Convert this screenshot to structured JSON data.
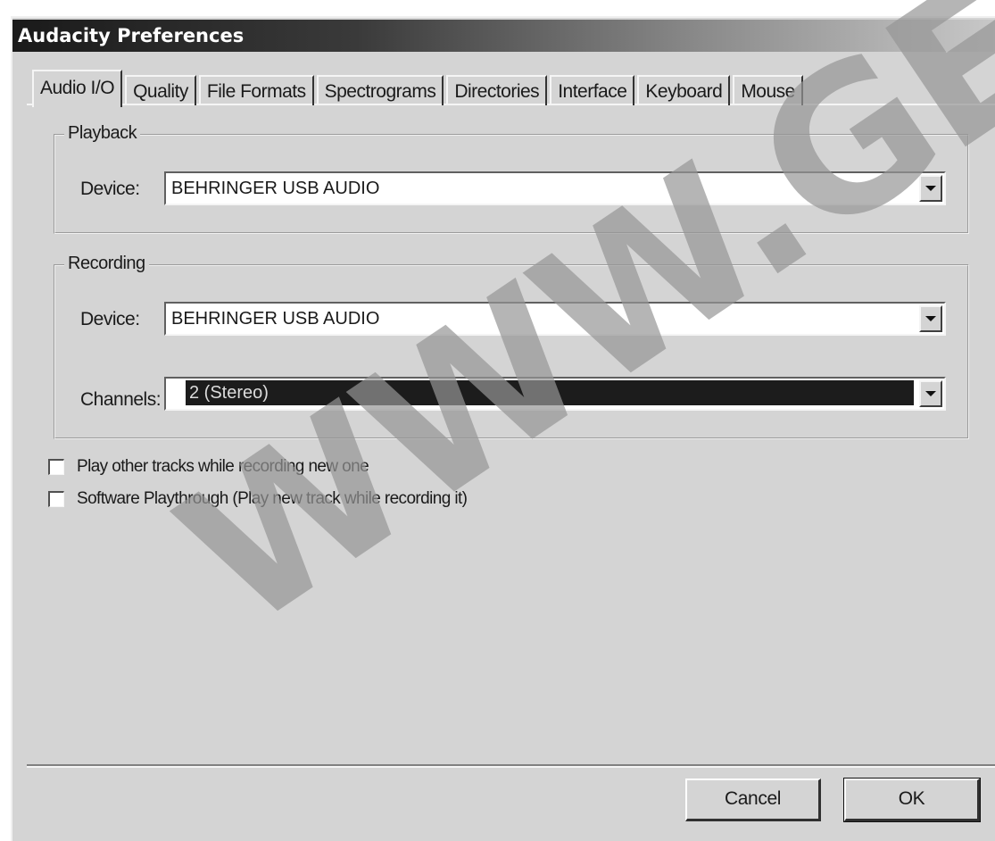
{
  "window": {
    "title": "Audacity Preferences"
  },
  "tabs": [
    {
      "label": "Audio I/O",
      "active": true
    },
    {
      "label": "Quality"
    },
    {
      "label": "File Formats"
    },
    {
      "label": "Spectrograms"
    },
    {
      "label": "Directories"
    },
    {
      "label": "Interface"
    },
    {
      "label": "Keyboard"
    },
    {
      "label": "Mouse"
    }
  ],
  "playback": {
    "group_label": "Playback",
    "device_label": "Device:",
    "device_value": "BEHRINGER USB AUDIO"
  },
  "recording": {
    "group_label": "Recording",
    "device_label": "Device:",
    "device_value": "BEHRINGER USB AUDIO",
    "channels_label": "Channels:",
    "channels_value": "2 (Stereo)"
  },
  "options": [
    {
      "label": "Play other tracks while recording new one",
      "checked": false
    },
    {
      "label": "Software Playthrough (Play new track while recording it)",
      "checked": false
    }
  ],
  "buttons": {
    "cancel": "Cancel",
    "ok": "OK"
  },
  "watermark": {
    "text": "WWW.GER"
  }
}
